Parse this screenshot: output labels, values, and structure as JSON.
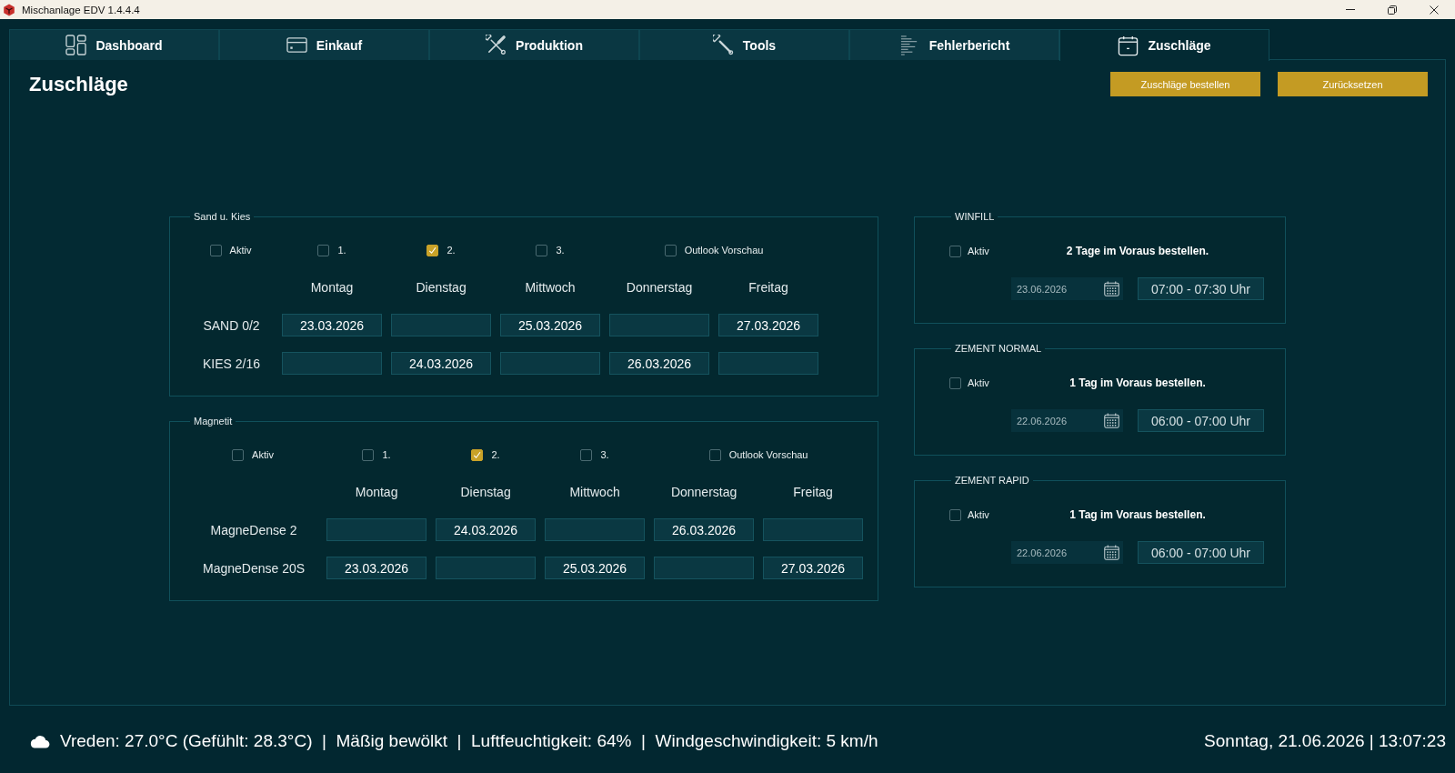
{
  "window": {
    "title": "Mischanlage EDV 1.4.4.4"
  },
  "tabs": [
    {
      "label": "Dashboard",
      "selected": false
    },
    {
      "label": "Einkauf",
      "selected": false
    },
    {
      "label": "Produktion",
      "selected": false
    },
    {
      "label": "Tools",
      "selected": false
    },
    {
      "label": "Fehlerbericht",
      "selected": false
    },
    {
      "label": "Zuschläge",
      "selected": true
    }
  ],
  "page": {
    "heading": "Zuschläge",
    "buttons": [
      "Zuschläge bestellen",
      "Zurücksetzen"
    ]
  },
  "material_groups": [
    {
      "title": "Sand u. Kies",
      "options": [
        {
          "label": "Aktiv",
          "checked": false
        },
        {
          "label": "1.",
          "checked": false
        },
        {
          "label": "2.",
          "checked": true
        },
        {
          "label": "3.",
          "checked": false
        },
        {
          "label": "Outlook Vorschau",
          "checked": false
        }
      ],
      "days": [
        "Montag",
        "Dienstag",
        "Mittwoch",
        "Donnerstag",
        "Freitag"
      ],
      "rows": [
        {
          "label": "SAND 0/2",
          "cells": [
            {
              "kind": "date",
              "value": "23.03.2026"
            },
            {
              "kind": "empty"
            },
            {
              "kind": "date",
              "value": "25.03.2026"
            },
            {
              "kind": "empty"
            },
            {
              "kind": "date",
              "value": "27.03.2026"
            }
          ]
        },
        {
          "label": "KIES 2/16",
          "cells": [
            {
              "kind": "empty"
            },
            {
              "kind": "date",
              "value": "24.03.2026"
            },
            {
              "kind": "empty"
            },
            {
              "kind": "date",
              "value": "26.03.2026"
            },
            {
              "kind": "empty"
            }
          ]
        }
      ]
    },
    {
      "title": "Magnetit",
      "options": [
        {
          "label": "Aktiv",
          "checked": false
        },
        {
          "label": "1.",
          "checked": false
        },
        {
          "label": "2.",
          "checked": true
        },
        {
          "label": "3.",
          "checked": false
        },
        {
          "label": "Outlook Vorschau",
          "checked": false
        }
      ],
      "days": [
        "Montag",
        "Dienstag",
        "Mittwoch",
        "Donnerstag",
        "Freitag"
      ],
      "rows": [
        {
          "label": "MagneDense 2",
          "cells": [
            {
              "kind": "empty"
            },
            {
              "kind": "date",
              "value": "24.03.2026"
            },
            {
              "kind": "empty"
            },
            {
              "kind": "date",
              "value": "26.03.2026"
            },
            {
              "kind": "empty"
            }
          ]
        },
        {
          "label": "MagneDense 20S",
          "cells": [
            {
              "kind": "date",
              "value": "23.03.2026"
            },
            {
              "kind": "empty"
            },
            {
              "kind": "date",
              "value": "25.03.2026"
            },
            {
              "kind": "empty"
            },
            {
              "kind": "date",
              "value": "27.03.2026"
            }
          ]
        }
      ]
    }
  ],
  "order_panels": [
    {
      "title": "WINFILL",
      "active": {
        "label": "Aktiv",
        "checked": false
      },
      "note": "2 Tage im Voraus bestellen.",
      "date": "23.06.2026",
      "time": "07:00 - 07:30 Uhr"
    },
    {
      "title": "ZEMENT NORMAL",
      "active": {
        "label": "Aktiv",
        "checked": false
      },
      "note": "1 Tag im Voraus bestellen.",
      "date": "22.06.2026",
      "time": "06:00 - 07:00 Uhr"
    },
    {
      "title": "ZEMENT RAPID",
      "active": {
        "label": "Aktiv",
        "checked": false
      },
      "note": "1 Tag im Voraus bestellen.",
      "date": "22.06.2026",
      "time": "06:00 - 07:00 Uhr"
    }
  ],
  "status_bar": {
    "weather": "Vreden: 27.0°C (Gefühlt: 28.3°C)  |  Mäßig bewölkt  |  Luftfeuchtigkeit: 64%  |  Windgeschwindigkeit: 5 km/h",
    "datetime": "Sonntag, 21.06.2026 | 13:07:23"
  }
}
